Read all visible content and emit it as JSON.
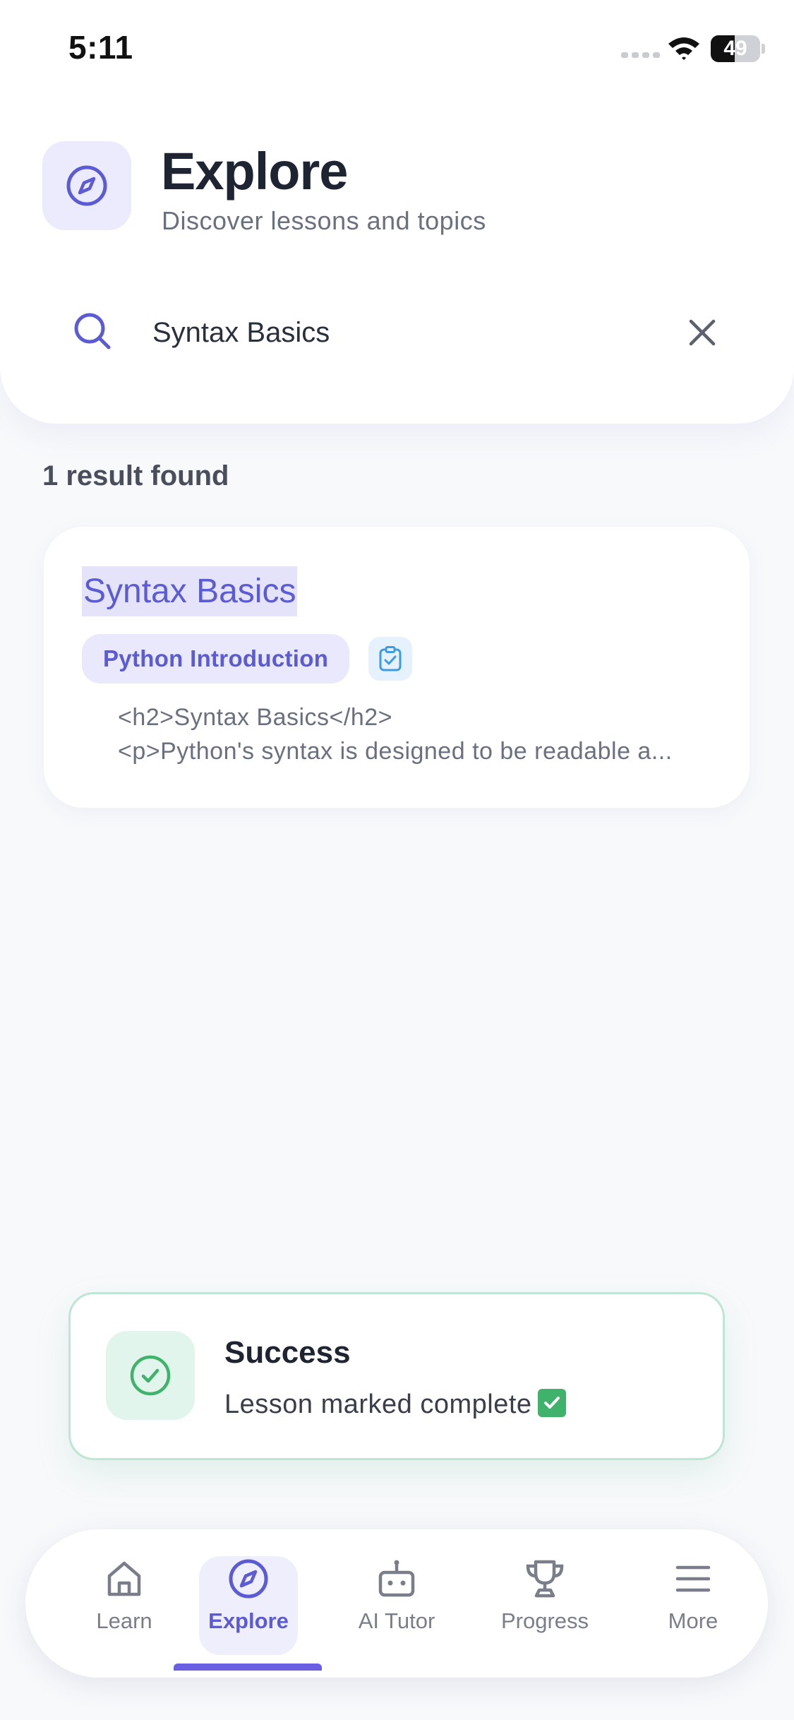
{
  "status_bar": {
    "time": "5:11",
    "battery": "49",
    "battery_level": 0.49
  },
  "header": {
    "title": "Explore",
    "subtitle": "Discover lessons and topics",
    "icon": "compass-icon"
  },
  "search": {
    "value": "Syntax Basics",
    "icon": "search-icon",
    "clear_icon": "close-icon"
  },
  "results": {
    "count_label": "1 result found",
    "items": [
      {
        "title": "Syntax Basics",
        "course_tag": "Python Introduction",
        "type_icon": "clipboard-check-icon",
        "preview_line1": "<h2>Syntax Basics</h2>",
        "preview_line2": "<p>Python's syntax is designed to be readable a..."
      }
    ]
  },
  "toast": {
    "title": "Success",
    "message": "Lesson marked complete",
    "emoji": "✅",
    "icon": "check-circle-icon"
  },
  "tab_bar": {
    "tabs": [
      {
        "label": "Learn",
        "icon": "home-icon"
      },
      {
        "label": "Explore",
        "icon": "compass-icon",
        "active": true
      },
      {
        "label": "AI Tutor",
        "icon": "robot-icon"
      },
      {
        "label": "Progress",
        "icon": "trophy-icon"
      },
      {
        "label": "More",
        "icon": "menu-icon"
      }
    ]
  },
  "colors": {
    "accent": "#5b5bd6",
    "success": "#3fb36b",
    "background": "#f8f9fb"
  }
}
